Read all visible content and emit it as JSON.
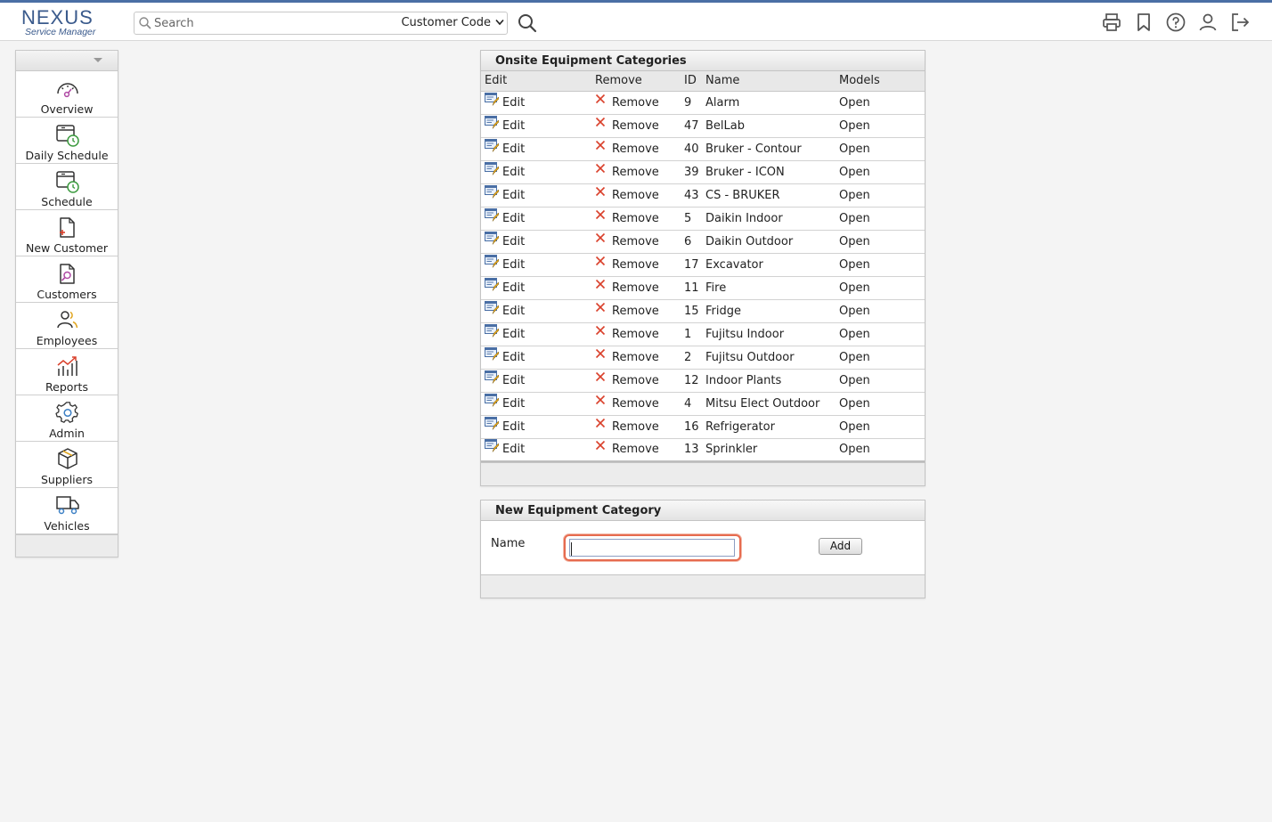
{
  "brand": {
    "name": "NEXUS",
    "subtitle": "Service Manager"
  },
  "search": {
    "placeholder": "Search",
    "field_selected": "Customer Code"
  },
  "toolbar_icons": [
    "print-icon",
    "bookmark-icon",
    "help-icon",
    "user-icon",
    "logout-icon"
  ],
  "sidebar": {
    "items": [
      {
        "label": "Overview",
        "icon": "gauge-icon"
      },
      {
        "label": "Daily Schedule",
        "icon": "calendar-clock-icon"
      },
      {
        "label": "Schedule",
        "icon": "calendar-clock-icon"
      },
      {
        "label": "New Customer",
        "icon": "new-document-icon"
      },
      {
        "label": "Customers",
        "icon": "search-document-icon"
      },
      {
        "label": "Employees",
        "icon": "people-icon"
      },
      {
        "label": "Reports",
        "icon": "chart-icon"
      },
      {
        "label": "Admin",
        "icon": "gear-icon"
      },
      {
        "label": "Suppliers",
        "icon": "box-icon"
      },
      {
        "label": "Vehicles",
        "icon": "truck-icon"
      }
    ]
  },
  "categories_panel": {
    "title": "Onsite Equipment Categories",
    "columns": {
      "edit": "Edit",
      "remove": "Remove",
      "id": "ID",
      "name": "Name",
      "models": "Models"
    },
    "edit_label": "Edit",
    "remove_label": "Remove",
    "models_label": "Open",
    "rows": [
      {
        "id": "9",
        "name": "Alarm"
      },
      {
        "id": "47",
        "name": "BelLab"
      },
      {
        "id": "40",
        "name": "Bruker - Contour"
      },
      {
        "id": "39",
        "name": "Bruker - ICON"
      },
      {
        "id": "43",
        "name": "CS - BRUKER"
      },
      {
        "id": "5",
        "name": "Daikin Indoor"
      },
      {
        "id": "6",
        "name": "Daikin Outdoor"
      },
      {
        "id": "17",
        "name": "Excavator"
      },
      {
        "id": "11",
        "name": "Fire"
      },
      {
        "id": "15",
        "name": "Fridge"
      },
      {
        "id": "1",
        "name": "Fujitsu Indoor"
      },
      {
        "id": "2",
        "name": "Fujitsu Outdoor"
      },
      {
        "id": "12",
        "name": "Indoor Plants"
      },
      {
        "id": "4",
        "name": "Mitsu Elect Outdoor"
      },
      {
        "id": "16",
        "name": "Refrigerator"
      },
      {
        "id": "13",
        "name": "Sprinkler"
      }
    ]
  },
  "new_category_panel": {
    "title": "New Equipment Category",
    "name_label": "Name",
    "name_value": "",
    "add_label": "Add"
  },
  "colors": {
    "accent": "#4a6fa5",
    "remove": "#d9402b",
    "focus": "#e66b4f"
  }
}
